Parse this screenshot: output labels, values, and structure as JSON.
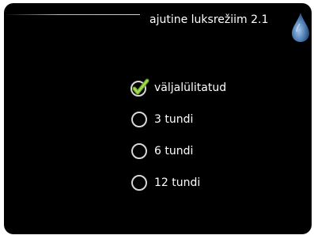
{
  "header": {
    "title": "ajutine luksrežiim 2.1",
    "icon": "water-drop-icon"
  },
  "options": [
    {
      "label": "väljalülitatud",
      "selected": true
    },
    {
      "label": "3 tundi",
      "selected": false
    },
    {
      "label": "6 tundi",
      "selected": false
    },
    {
      "label": "12 tundi",
      "selected": false
    }
  ],
  "colors": {
    "background": "#000000",
    "text": "#ffffff",
    "check_green": "#8cc63f",
    "drop_blue": "#3a6ea5"
  }
}
